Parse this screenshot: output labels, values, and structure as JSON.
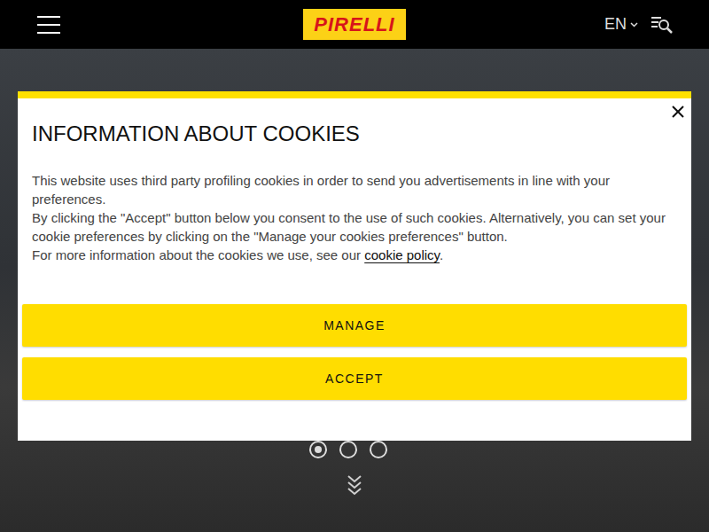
{
  "header": {
    "logo": "PIRELLI",
    "language": "EN"
  },
  "cookie_dialog": {
    "title": "INFORMATION ABOUT COOKIES",
    "paragraphs": [
      "This website uses third party profiling cookies in order to send you advertisements in line with your preferences.",
      "By clicking the \"Accept\" button below you consent to the use of such cookies. Alternatively, you can set your cookie preferences by clicking on the \"Manage your cookies preferences\" button."
    ],
    "policy_line": {
      "before": "For more information about the cookies we use, see our ",
      "link": "cookie policy",
      "after": "."
    },
    "buttons": [
      "MANAGE",
      "ACCEPT"
    ]
  },
  "carousel": {
    "dots": [
      {
        "selected": true
      },
      {
        "selected": false
      },
      {
        "selected": false
      }
    ]
  }
}
